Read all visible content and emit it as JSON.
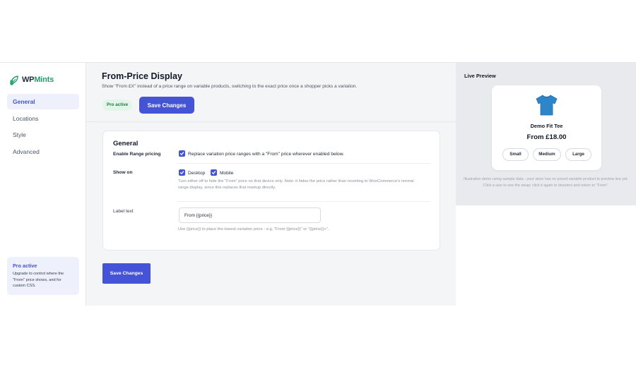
{
  "brand": {
    "name_part1": "WP",
    "name_part2": "Mints"
  },
  "sidebar": {
    "items": [
      {
        "label": "General",
        "active": true
      },
      {
        "label": "Locations"
      },
      {
        "label": "Style"
      },
      {
        "label": "Advanced"
      }
    ],
    "pro_box": {
      "title": "Pro active",
      "description": "Upgrade to control where the \"From\" price shows, and for custom CSS."
    }
  },
  "header": {
    "title": "From-Price Display",
    "subtitle": "Show \"From £X\" instead of a price range on variable products, switching to the exact price once a shopper picks a variation.",
    "badge": "Pro active",
    "save_label": "Save Changes"
  },
  "general": {
    "title": "General",
    "enable": {
      "label": "Enable Range pricing",
      "checkbox_text": "Replace variation price ranges with a \"From\" price wherever enabled below.",
      "checked": true
    },
    "show_on": {
      "label": "Show on",
      "desktop": "Desktop",
      "mobile": "Mobile",
      "desktop_checked": true,
      "mobile_checked": true,
      "help": "Turn either off to hide the \"From\" price on that device only. Note: it hides the price rather than reverting to WooCommerce's normal range display, since this replaces that markup directly."
    },
    "label_text": {
      "label": "Label text",
      "value": "From {{price}}",
      "help": "Use {{price}} to place the lowest variation price - e.g. \"From {{price}}\" or \"{{price}}+\"."
    }
  },
  "footer": {
    "save_label": "Save Changes"
  },
  "preview": {
    "title": "Live Preview",
    "product_name": "Demo Fit Tee",
    "price": "From £18.00",
    "sizes": [
      "Small",
      "Medium",
      "Large"
    ],
    "note": "Illustrative demo using sample data - your store has no priced variable product to preview live yet. Click a size to see the swap; click it again to deselect and return to \"From\"."
  },
  "colors": {
    "accent": "#4553d6",
    "brand_green": "#22a06b",
    "badge_bg": "#e3f5e9",
    "tee": "#2e86c9"
  },
  "icons": {
    "logo": "leaf-logo-icon",
    "check": "check-icon",
    "product": "tshirt-icon"
  }
}
